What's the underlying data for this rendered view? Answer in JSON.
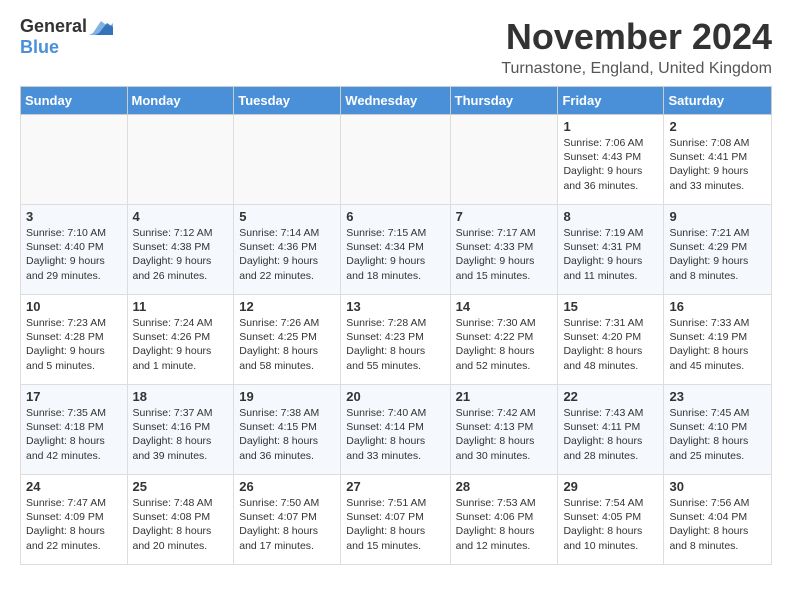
{
  "header": {
    "logo_general": "General",
    "logo_blue": "Blue",
    "month_title": "November 2024",
    "location": "Turnastone, England, United Kingdom"
  },
  "days_of_week": [
    "Sunday",
    "Monday",
    "Tuesday",
    "Wednesday",
    "Thursday",
    "Friday",
    "Saturday"
  ],
  "weeks": [
    [
      {
        "day": "",
        "info": ""
      },
      {
        "day": "",
        "info": ""
      },
      {
        "day": "",
        "info": ""
      },
      {
        "day": "",
        "info": ""
      },
      {
        "day": "",
        "info": ""
      },
      {
        "day": "1",
        "info": "Sunrise: 7:06 AM\nSunset: 4:43 PM\nDaylight: 9 hours and 36 minutes."
      },
      {
        "day": "2",
        "info": "Sunrise: 7:08 AM\nSunset: 4:41 PM\nDaylight: 9 hours and 33 minutes."
      }
    ],
    [
      {
        "day": "3",
        "info": "Sunrise: 7:10 AM\nSunset: 4:40 PM\nDaylight: 9 hours and 29 minutes."
      },
      {
        "day": "4",
        "info": "Sunrise: 7:12 AM\nSunset: 4:38 PM\nDaylight: 9 hours and 26 minutes."
      },
      {
        "day": "5",
        "info": "Sunrise: 7:14 AM\nSunset: 4:36 PM\nDaylight: 9 hours and 22 minutes."
      },
      {
        "day": "6",
        "info": "Sunrise: 7:15 AM\nSunset: 4:34 PM\nDaylight: 9 hours and 18 minutes."
      },
      {
        "day": "7",
        "info": "Sunrise: 7:17 AM\nSunset: 4:33 PM\nDaylight: 9 hours and 15 minutes."
      },
      {
        "day": "8",
        "info": "Sunrise: 7:19 AM\nSunset: 4:31 PM\nDaylight: 9 hours and 11 minutes."
      },
      {
        "day": "9",
        "info": "Sunrise: 7:21 AM\nSunset: 4:29 PM\nDaylight: 9 hours and 8 minutes."
      }
    ],
    [
      {
        "day": "10",
        "info": "Sunrise: 7:23 AM\nSunset: 4:28 PM\nDaylight: 9 hours and 5 minutes."
      },
      {
        "day": "11",
        "info": "Sunrise: 7:24 AM\nSunset: 4:26 PM\nDaylight: 9 hours and 1 minute."
      },
      {
        "day": "12",
        "info": "Sunrise: 7:26 AM\nSunset: 4:25 PM\nDaylight: 8 hours and 58 minutes."
      },
      {
        "day": "13",
        "info": "Sunrise: 7:28 AM\nSunset: 4:23 PM\nDaylight: 8 hours and 55 minutes."
      },
      {
        "day": "14",
        "info": "Sunrise: 7:30 AM\nSunset: 4:22 PM\nDaylight: 8 hours and 52 minutes."
      },
      {
        "day": "15",
        "info": "Sunrise: 7:31 AM\nSunset: 4:20 PM\nDaylight: 8 hours and 48 minutes."
      },
      {
        "day": "16",
        "info": "Sunrise: 7:33 AM\nSunset: 4:19 PM\nDaylight: 8 hours and 45 minutes."
      }
    ],
    [
      {
        "day": "17",
        "info": "Sunrise: 7:35 AM\nSunset: 4:18 PM\nDaylight: 8 hours and 42 minutes."
      },
      {
        "day": "18",
        "info": "Sunrise: 7:37 AM\nSunset: 4:16 PM\nDaylight: 8 hours and 39 minutes."
      },
      {
        "day": "19",
        "info": "Sunrise: 7:38 AM\nSunset: 4:15 PM\nDaylight: 8 hours and 36 minutes."
      },
      {
        "day": "20",
        "info": "Sunrise: 7:40 AM\nSunset: 4:14 PM\nDaylight: 8 hours and 33 minutes."
      },
      {
        "day": "21",
        "info": "Sunrise: 7:42 AM\nSunset: 4:13 PM\nDaylight: 8 hours and 30 minutes."
      },
      {
        "day": "22",
        "info": "Sunrise: 7:43 AM\nSunset: 4:11 PM\nDaylight: 8 hours and 28 minutes."
      },
      {
        "day": "23",
        "info": "Sunrise: 7:45 AM\nSunset: 4:10 PM\nDaylight: 8 hours and 25 minutes."
      }
    ],
    [
      {
        "day": "24",
        "info": "Sunrise: 7:47 AM\nSunset: 4:09 PM\nDaylight: 8 hours and 22 minutes."
      },
      {
        "day": "25",
        "info": "Sunrise: 7:48 AM\nSunset: 4:08 PM\nDaylight: 8 hours and 20 minutes."
      },
      {
        "day": "26",
        "info": "Sunrise: 7:50 AM\nSunset: 4:07 PM\nDaylight: 8 hours and 17 minutes."
      },
      {
        "day": "27",
        "info": "Sunrise: 7:51 AM\nSunset: 4:07 PM\nDaylight: 8 hours and 15 minutes."
      },
      {
        "day": "28",
        "info": "Sunrise: 7:53 AM\nSunset: 4:06 PM\nDaylight: 8 hours and 12 minutes."
      },
      {
        "day": "29",
        "info": "Sunrise: 7:54 AM\nSunset: 4:05 PM\nDaylight: 8 hours and 10 minutes."
      },
      {
        "day": "30",
        "info": "Sunrise: 7:56 AM\nSunset: 4:04 PM\nDaylight: 8 hours and 8 minutes."
      }
    ]
  ]
}
